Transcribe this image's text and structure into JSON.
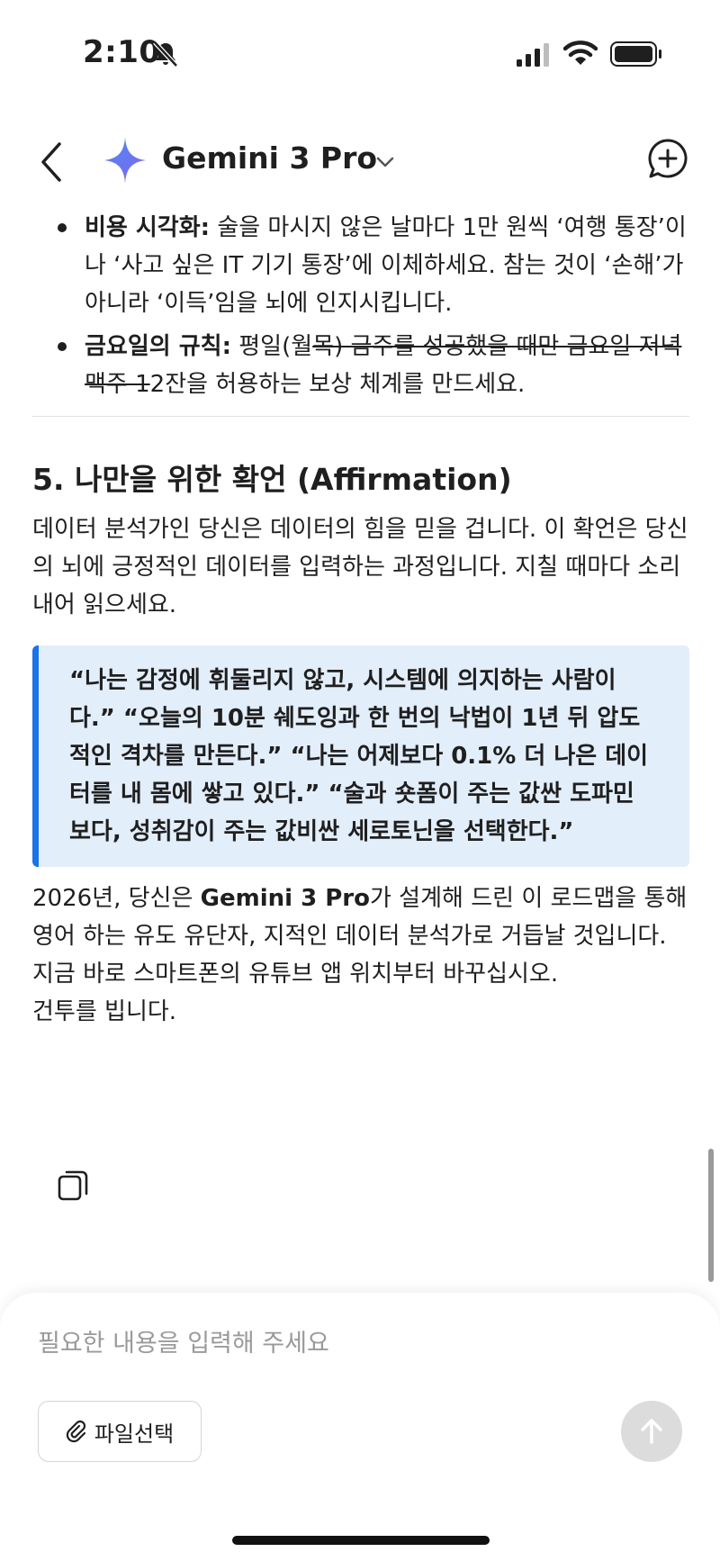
{
  "status_bar": {
    "time": "2:10",
    "icons": [
      "bell-slash-icon",
      "cellular-signal-icon",
      "wifi-icon",
      "battery-icon"
    ]
  },
  "header": {
    "model_name": "Gemini 3 Pro",
    "icons": [
      "back-chevron-icon",
      "gemini-sparkle-icon",
      "chevron-down-icon",
      "new-chat-icon"
    ]
  },
  "bullets": [
    {
      "label": "비용 시각화:",
      "text": " 술을 마시지 않은 날마다 1만 원씩 ‘여행 통장’이나 ‘사고 싶은 IT 기기 통장’에 이체하세요. 참는 것이 ‘손해’가 아니라 ‘이득’임을 뇌에 인지시킵니다."
    },
    {
      "label": "금요일의 규칙:",
      "text_plain": " 평일(월",
      "text_strike": "목) 금주를 성공했을 때만 금요일 저녁 맥주 1",
      "text_after": "2잔을 허용하는 보상 체계를 만드세요."
    }
  ],
  "section": {
    "heading": "5. 나만을 위한 확언 (Affirmation)",
    "intro": "데이터 분석가인 당신은 데이터의 힘을 믿을 겁니다. 이 확언은 당신의 뇌에 긍정적인 데이터를 입력하는 과정입니다. 지칠 때마다 소리 내어 읽으세요.",
    "affirmation": "“나는 감정에 휘둘리지 않고, 시스템에 의지하는 사람이다.” “오늘의 10분 쉐도잉과 한 번의 낙법이 1년 뒤 압도적인 격차를 만든다.” “나는 어제보다 0.1% 더 나은 데이터를 내 몸에 쌓고 있다.” “술과 숏폼이 주는 값싼 도파민보다, 성취감이 주는 값비싼 세로토닌을 선택한다.”",
    "closing_pre": "2026년, 당신은 ",
    "closing_bold": "Gemini 3 Pro",
    "closing_post": "가 설계해 드린 이 로드맵을 통해 영어 하는 유도 유단자, 지적인 데이터 분석가로 거듭날 것입니다. 지금 바로 스마트폰의 유튜브 앱 위치부터 바꾸십시오.",
    "sign_off": "건투를 빕니다."
  },
  "actions": {
    "copy_icon": "copy-icon"
  },
  "composer": {
    "placeholder": "필요한 내용을 입력해 주세요",
    "file_button_label": "파일선택",
    "icons": [
      "paperclip-icon",
      "arrow-up-icon"
    ]
  },
  "colors": {
    "accent": "#1a73e8",
    "quote_background": "#e3eefb",
    "send_button_disabled": "#dcdcdc"
  }
}
